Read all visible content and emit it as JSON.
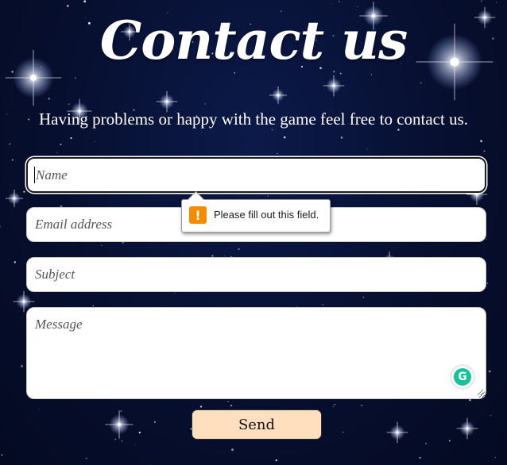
{
  "header": {
    "title": "Contact us",
    "subtitle": "Having problems or happy with the game feel free to contact us."
  },
  "form": {
    "name_placeholder": "Name",
    "email_placeholder": "Email address",
    "subject_placeholder": "Subject",
    "message_placeholder": "Message",
    "send_label": "Send"
  },
  "validation_tooltip": {
    "icon": "warning-icon",
    "text": "Please fill out this field."
  },
  "grammarly": {
    "icon": "grammarly-icon",
    "letter": "G"
  },
  "colors": {
    "background": "#070f2f",
    "send_button": "#ffdfbe",
    "warning": "#f48b00",
    "grammarly": "#15c39a"
  }
}
